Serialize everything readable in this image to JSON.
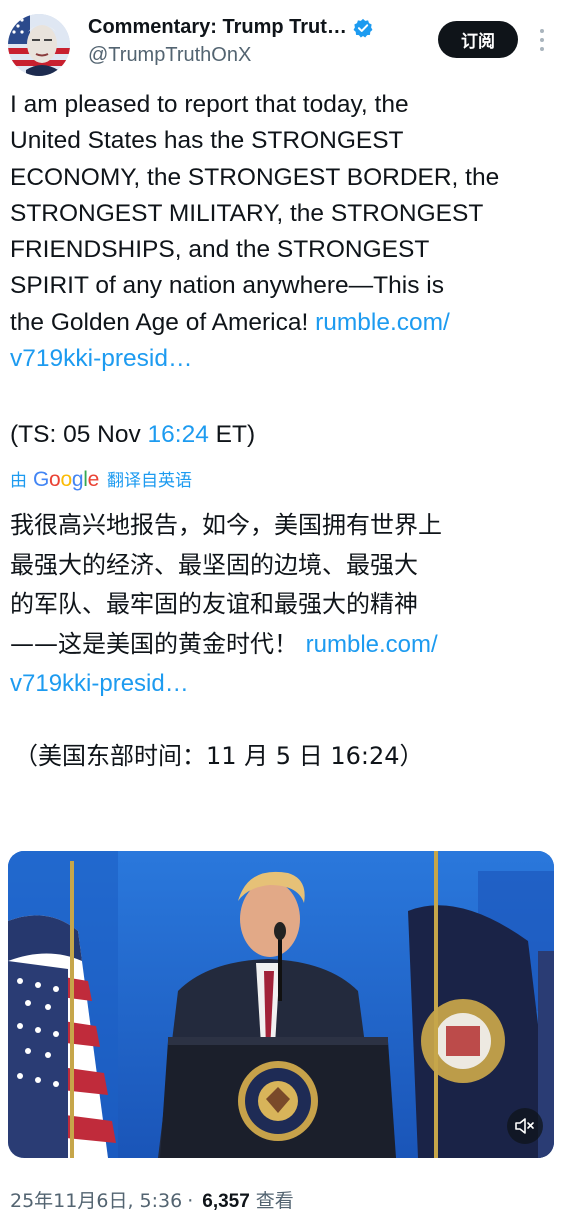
{
  "header": {
    "display_name": "Commentary: Trump Trut…",
    "handle": "@TrumpTruthOnX",
    "subscribe_label": "订阅"
  },
  "tweet": {
    "text_lines": [
      "I am pleased to report that today, the",
      "United States has the STRONGEST",
      "ECONOMY, the STRONGEST BORDER, the",
      "STRONGEST MILITARY, the STRONGEST",
      "FRIENDSHIPS, and the STRONGEST",
      "SPIRIT of any nation anywhere—This is",
      "the Golden Age of America! "
    ],
    "link_part1": "rumble.com/",
    "link_part2": "v719kki-presid…",
    "ts_prefix": "(TS: 05 Nov ",
    "ts_time": "16:24",
    "ts_suffix": " ET)"
  },
  "translation": {
    "by_label": "由",
    "google_letters": [
      "G",
      "o",
      "o",
      "g",
      "l",
      "e"
    ],
    "translate_label": "翻译自英语",
    "zh_lines": [
      "我很高兴地报告，如今，美国拥有世界上",
      "最强大的经济、最坚固的边境、最强大",
      "的军队、最牢固的友谊和最强大的精神",
      "——这是美国的黄金时代！ "
    ],
    "zh_link_part1": "rumble.com/",
    "zh_link_part2": "v719kki-presid…",
    "zh_time": "（美国东部时间：11 月 5 日 16:24）"
  },
  "footer": {
    "date": "25年11月6日, 5:36",
    "dot": "·",
    "views_count": "6,357",
    "views_label": "查看"
  },
  "colors": {
    "link": "#1d9bf0",
    "text": "#0f1419",
    "secondary": "#536471",
    "google_blue": "#4285f4",
    "google_red": "#ea4335",
    "google_yellow": "#fbbc05",
    "google_green": "#34a853"
  },
  "icons": {
    "verified": "verified-badge-icon",
    "more": "more-vertical-icon",
    "mute": "volume-muted-icon"
  }
}
